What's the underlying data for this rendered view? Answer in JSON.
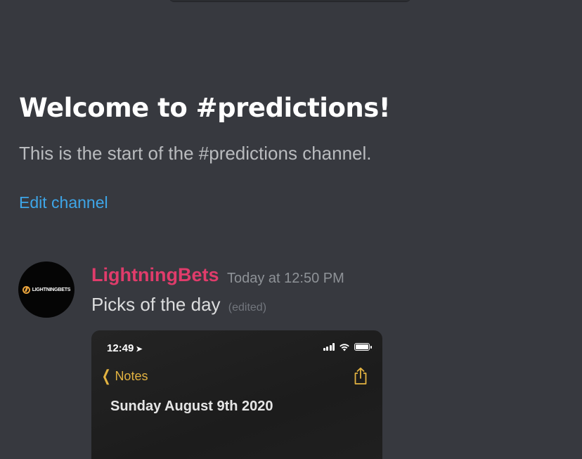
{
  "channel": {
    "welcome_title": "Welcome to #predictions!",
    "welcome_subtitle": "This is the start of the #predictions channel.",
    "edit_link": "Edit channel"
  },
  "message": {
    "author": "LightningBets",
    "avatar_text": "LIGHTNINGBETS",
    "timestamp": "Today at 12:50 PM",
    "text": "Picks of the day",
    "edited_label": "(edited)",
    "author_color": "#e03c6b"
  },
  "attachment": {
    "status_time": "12:49",
    "back_label": "Notes",
    "note_title": "Sunday August 9th 2020",
    "accent_color": "#e3b341",
    "icons": [
      "location-arrow-icon",
      "signal-icon",
      "wifi-icon",
      "battery-icon",
      "chevron-left-icon",
      "share-icon"
    ]
  },
  "colors": {
    "background": "#37393f",
    "link": "#3ea6e8",
    "muted": "#8e9297"
  }
}
